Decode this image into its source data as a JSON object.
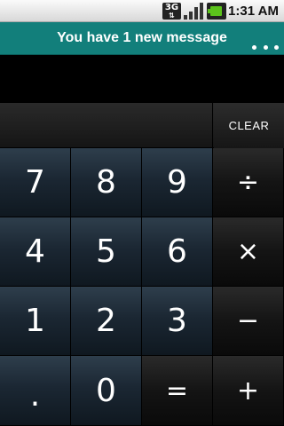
{
  "status_bar": {
    "network_label": "3G",
    "network_arrows": "⇅",
    "time": "1:31 AM",
    "battery_color": "#5bc21b"
  },
  "notification": {
    "text": "You have 1 new message",
    "background_color": "#127f7b"
  },
  "display": {
    "value": "",
    "clear_label": "CLEAR"
  },
  "keypad": {
    "keys": [
      {
        "label": "7"
      },
      {
        "label": "8"
      },
      {
        "label": "9"
      },
      {
        "label": "÷"
      },
      {
        "label": "4"
      },
      {
        "label": "5"
      },
      {
        "label": "6"
      },
      {
        "label": "×"
      },
      {
        "label": "1"
      },
      {
        "label": "2"
      },
      {
        "label": "3"
      },
      {
        "label": "−"
      },
      {
        "label": "."
      },
      {
        "label": "0"
      },
      {
        "label": "="
      },
      {
        "label": "+"
      }
    ]
  }
}
